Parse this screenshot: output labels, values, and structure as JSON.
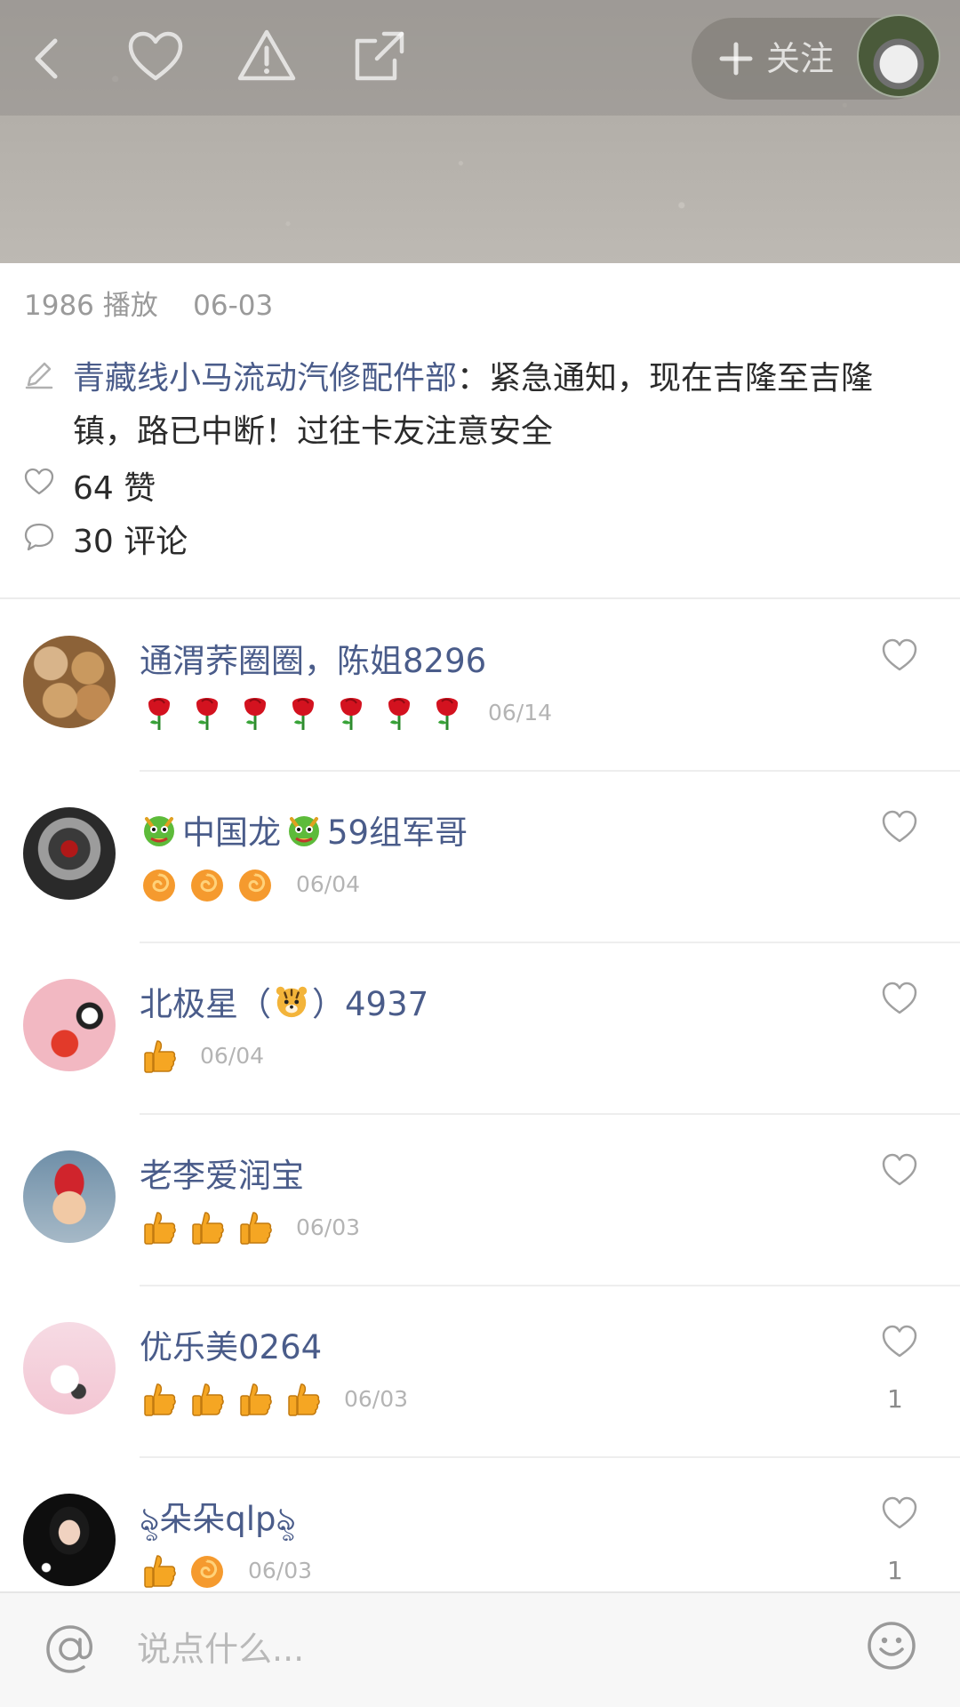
{
  "video": {
    "follow_label": "关注"
  },
  "post": {
    "plays": "1986 播放",
    "date": "06-03",
    "author": "青藏线小马流动汽修配件部",
    "separator": "：",
    "text": "紧急通知，现在吉隆至吉隆镇，路已中断！过往卡友注意安全",
    "likes": "64 赞",
    "comments": "30 评论"
  },
  "comments": [
    {
      "name": "通渭荞圈圈，陈姐8296",
      "emojis": [
        "rose-icon",
        "rose-icon",
        "rose-icon",
        "rose-icon",
        "rose-icon",
        "rose-icon",
        "rose-icon"
      ],
      "date": "06/14",
      "like_count": ""
    },
    {
      "name_pre": "",
      "name_mid": "中国龙",
      "name_post": "59组军哥",
      "emojis": [
        "swirl-icon",
        "swirl-icon",
        "swirl-icon"
      ],
      "date": "06/04",
      "like_count": ""
    },
    {
      "name_pre": "北极星（",
      "name_post": "）4937",
      "emojis": [
        "thumbs-up-icon"
      ],
      "date": "06/04",
      "like_count": ""
    },
    {
      "name": "老李爱润宝",
      "emojis": [
        "thumbs-up-icon",
        "thumbs-up-icon",
        "thumbs-up-icon"
      ],
      "date": "06/03",
      "like_count": ""
    },
    {
      "name": "优乐美0264",
      "emojis": [
        "thumbs-up-icon",
        "thumbs-up-icon",
        "thumbs-up-icon",
        "thumbs-up-icon"
      ],
      "date": "06/03",
      "like_count": "1"
    },
    {
      "name": "ৡ朵朵qlpৡ",
      "emojis": [
        "thumbs-up-icon",
        "swirl-icon"
      ],
      "date": "06/03",
      "like_count": "1"
    }
  ],
  "input": {
    "placeholder": "说点什么..."
  }
}
